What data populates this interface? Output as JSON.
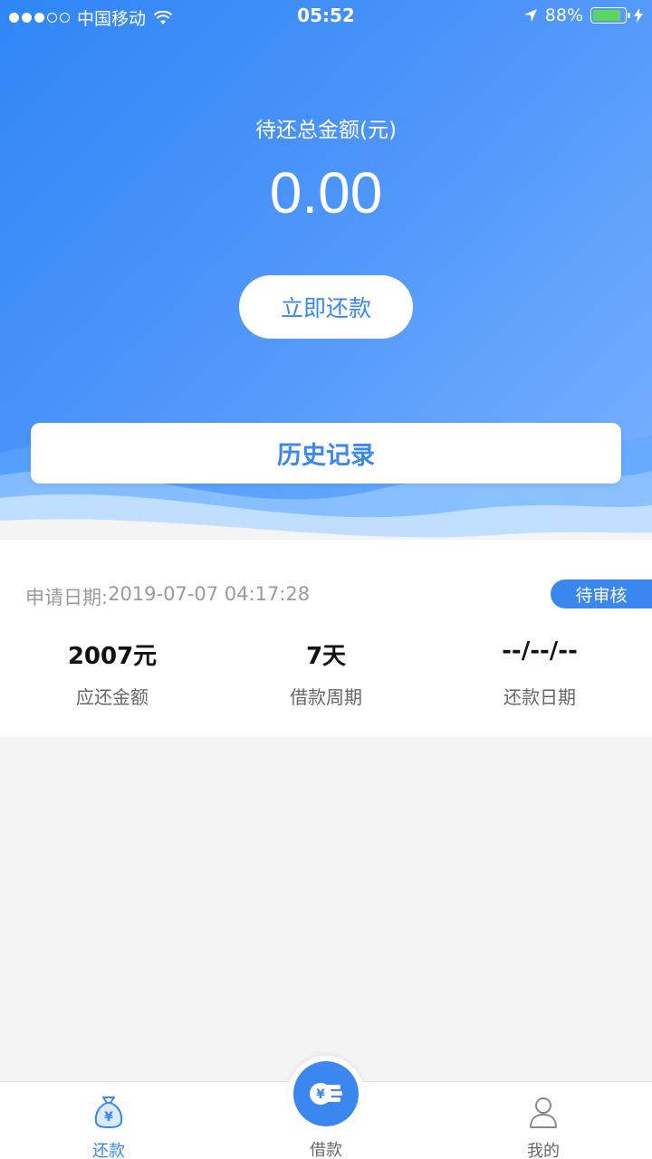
{
  "status_bar": {
    "carrier": "中国移动",
    "time": "05:52",
    "battery": "88%"
  },
  "summary": {
    "label": "待还总金额(元)",
    "amount": "0.00",
    "repay_button": "立即还款",
    "history_button": "历史记录"
  },
  "record": {
    "apply_label": "申请日期:",
    "apply_date": "2019-07-07 04:17:28",
    "status": "待审核",
    "stats": [
      {
        "value": "2007元",
        "label": "应还金额"
      },
      {
        "value": "7天",
        "label": "借款周期"
      },
      {
        "value": "--/--/--",
        "label": "还款日期"
      }
    ]
  },
  "tabbar": {
    "tabs": [
      {
        "label": "还款",
        "icon": "money-bag-icon",
        "active": true
      },
      {
        "label": "借款",
        "icon": "coins-icon",
        "active": false
      },
      {
        "label": "我的",
        "icon": "user-icon",
        "active": false
      }
    ],
    "accent": "#3a87f0"
  },
  "colors": {
    "gradient_start": "#2f86f6",
    "gradient_end": "#79b1ff"
  }
}
